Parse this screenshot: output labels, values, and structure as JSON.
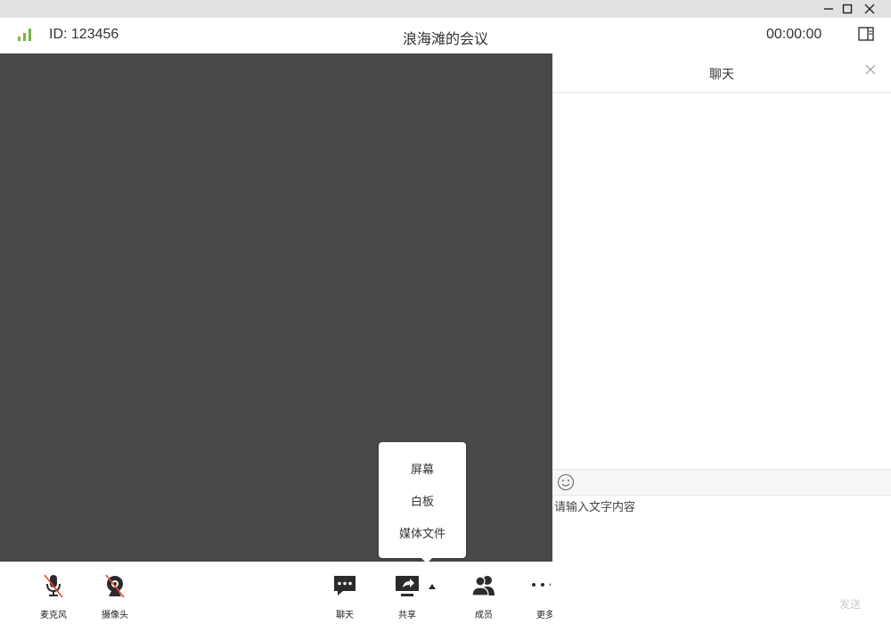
{
  "window": {
    "controls": [
      {
        "name": "minimize",
        "icon": "minimize-icon"
      },
      {
        "name": "maximize",
        "icon": "maximize-icon"
      },
      {
        "name": "close",
        "icon": "close-icon"
      }
    ]
  },
  "header": {
    "signal_icon": "signal-bars-icon",
    "signal_color": "#7ab442",
    "meeting_id": "ID: 123456",
    "meeting_title": "浪海滩的会议",
    "timer": "00:00:00",
    "layout_icon": "panel-layout-icon"
  },
  "video": {
    "background": "#494949"
  },
  "toolbar": {
    "items": [
      {
        "label": "麦克风",
        "icon": "microphone-muted-icon"
      },
      {
        "label": "摄像头",
        "icon": "camera-off-icon"
      },
      {
        "label": "聊天",
        "icon": "chat-bubble-icon"
      },
      {
        "label": "共享",
        "icon": "share-screen-icon"
      },
      {
        "label": "成员",
        "icon": "members-icon"
      },
      {
        "label": "更多",
        "icon": "more-icon"
      }
    ]
  },
  "share_menu": {
    "items": [
      "屏幕",
      "白板",
      "媒体文件"
    ]
  },
  "chat": {
    "title": "聊天",
    "close_icon": "close-icon",
    "emoji_icon": "emoji-icon",
    "input_placeholder": "请输入文字内容",
    "send_label": "发送"
  },
  "colors": {
    "muted_slash": "#e24a3b",
    "icon_dark": "#2b2b2b"
  }
}
